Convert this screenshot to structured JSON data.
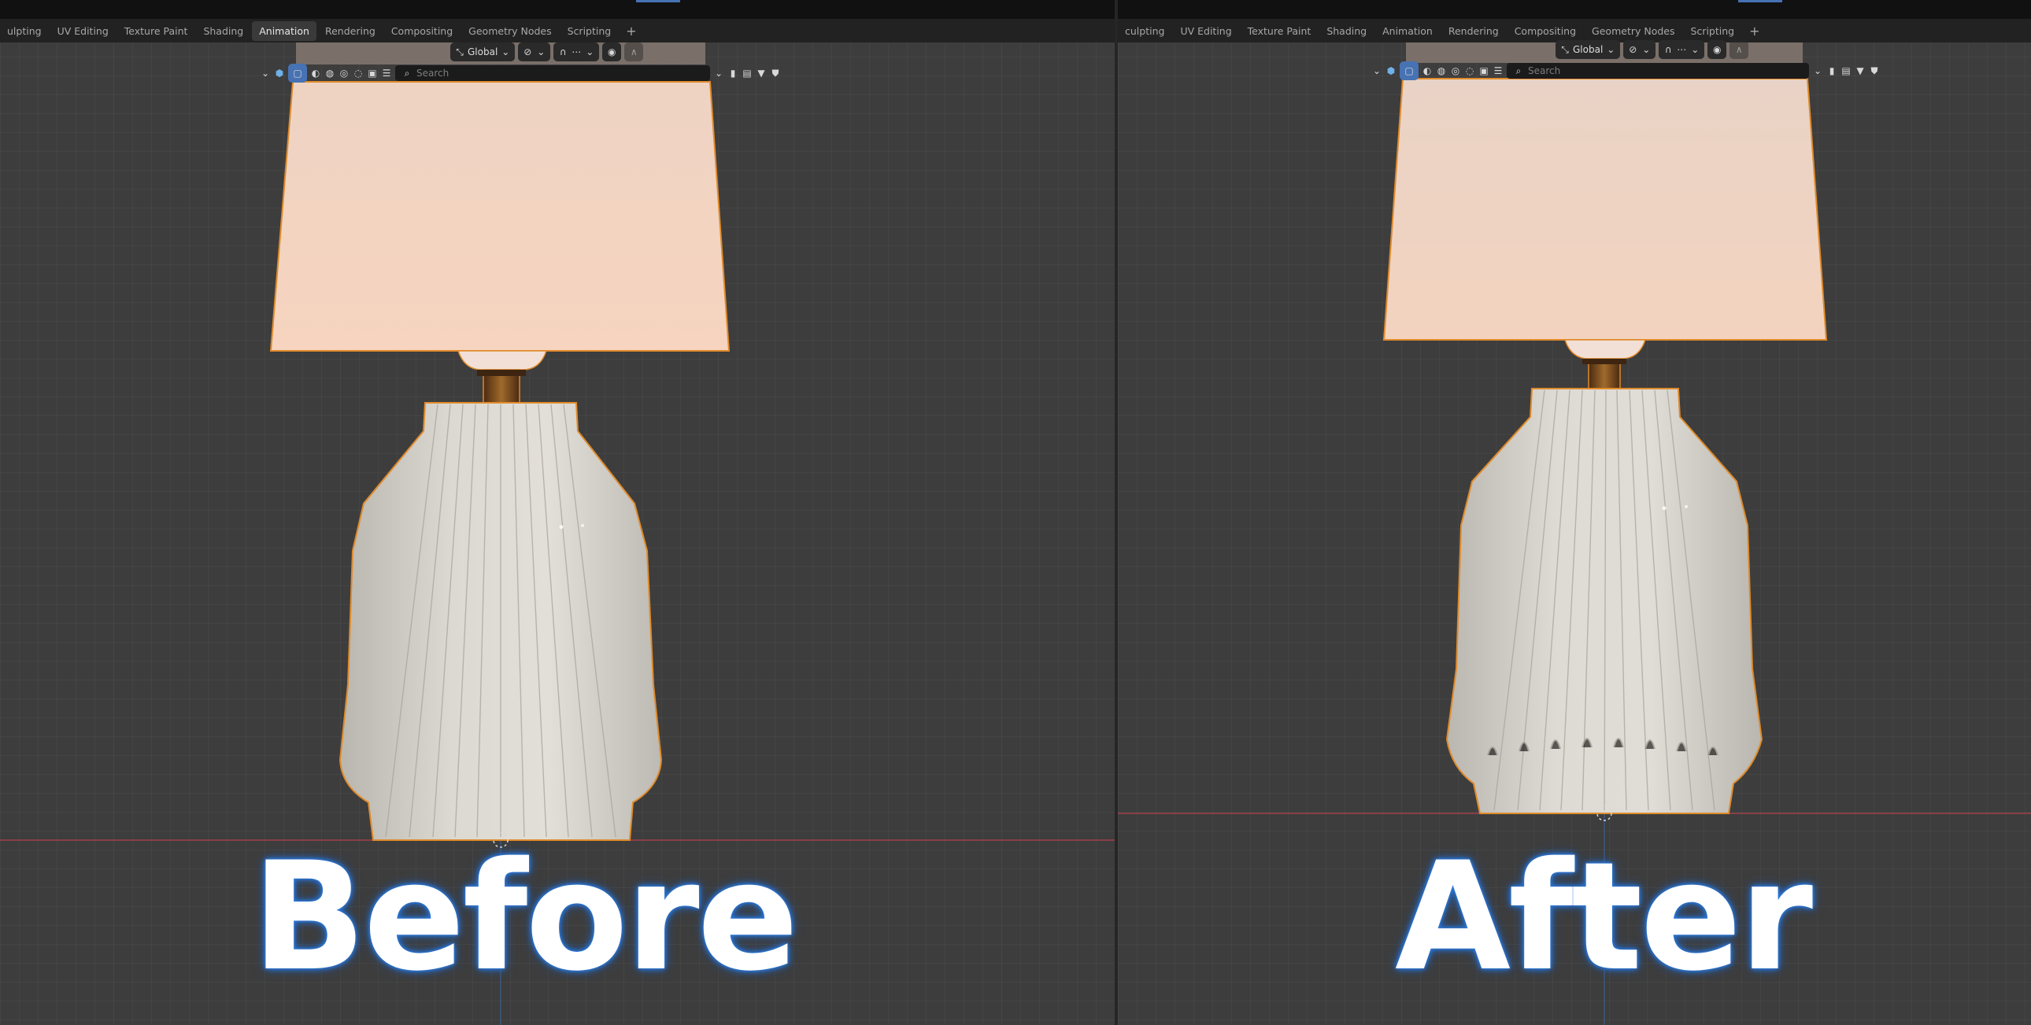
{
  "workspace_tabs_left": [
    "ulpting",
    "UV Editing",
    "Texture Paint",
    "Shading",
    "Animation",
    "Rendering",
    "Compositing",
    "Geometry Nodes",
    "Scripting",
    "+"
  ],
  "workspace_tabs_right": [
    "culpting",
    "UV Editing",
    "Texture Paint",
    "Shading",
    "Animation",
    "Rendering",
    "Compositing",
    "Geometry Nodes",
    "Scripting",
    "+"
  ],
  "active_tab_left": "Animation",
  "transform_orientation": "Global",
  "search_placeholder": "Search",
  "captions": {
    "before": "Before",
    "after": "After"
  },
  "icons": {
    "orientation": "axes-icon",
    "pivot": "pivot-icon",
    "snap": "magnet-icon",
    "proportional": "proportional-edit-icon",
    "search": "search-icon",
    "filter": "filter-icon",
    "bookmark": "bookmark-icon",
    "shield": "shield-icon"
  },
  "colors": {
    "viewport_bg": "#3d3d3d",
    "selection_outline": "#e08a2a",
    "lampshade": "#f3d2bd",
    "vase": "#d5d2cb",
    "caption_glow": "#2f7de0",
    "x_axis": "#a0404a",
    "tab_active_bg": "#3a3a3a",
    "accent": "#4772b3"
  }
}
